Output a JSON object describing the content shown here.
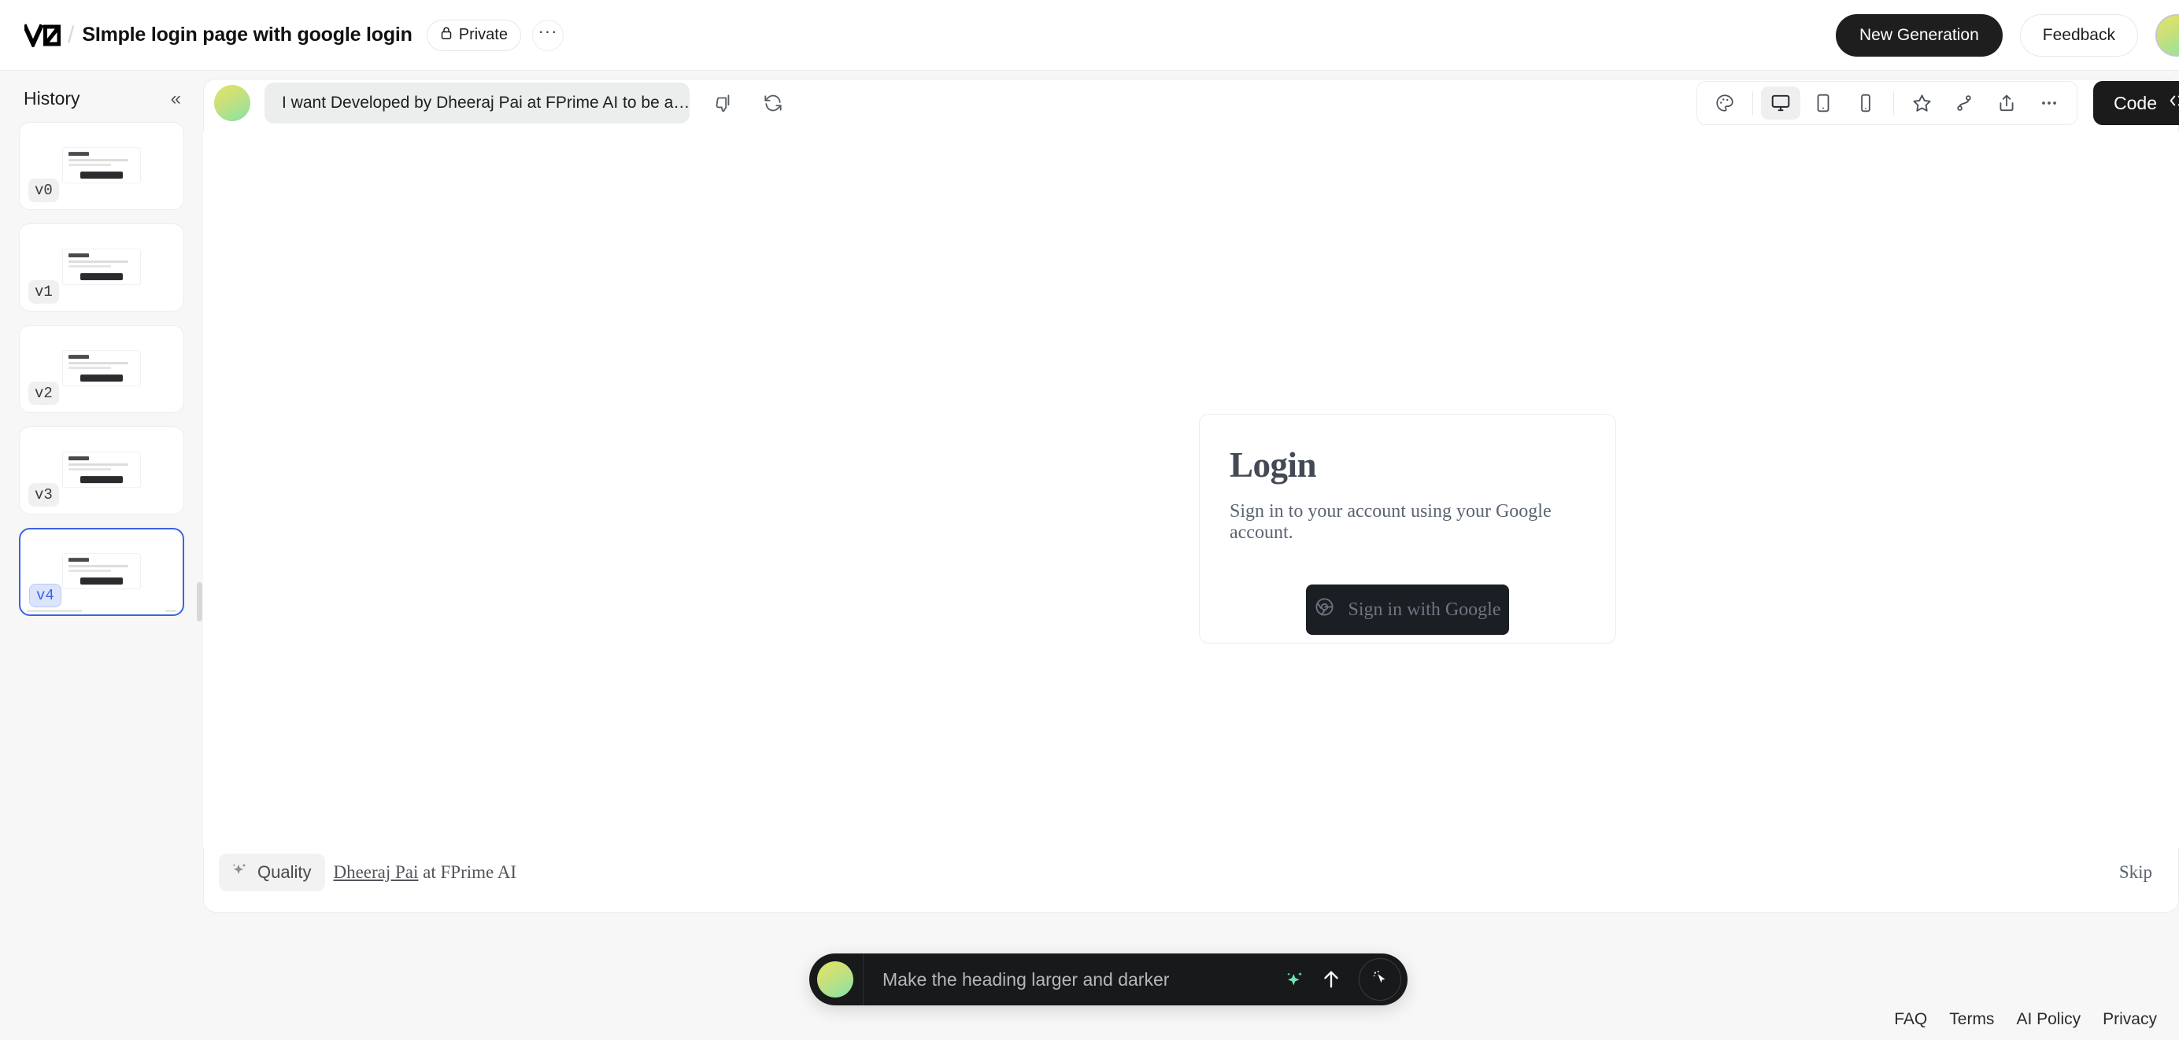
{
  "header": {
    "logo_icon": "v0-logo-icon",
    "separator": "/",
    "project_title": "SImple login page with google login",
    "privacy_label": "Private",
    "privacy_icon": "lock-icon",
    "more_label": "···",
    "new_generation_label": "New Generation",
    "feedback_label": "Feedback",
    "avatar_icon": "user-avatar"
  },
  "sidebar": {
    "title": "History",
    "collapse_icon": "chevrons-left-icon",
    "versions": [
      {
        "label": "v0",
        "selected": false
      },
      {
        "label": "v1",
        "selected": false
      },
      {
        "label": "v2",
        "selected": false
      },
      {
        "label": "v3",
        "selected": false
      },
      {
        "label": "v4",
        "selected": true
      }
    ]
  },
  "preview": {
    "prompt_message": "I want Developed by Dheeraj Pai at FPrime AI to be a…",
    "thumbs_down_icon": "thumbs-down-icon",
    "refresh_icon": "refresh-icon",
    "viewbar": {
      "theme_icon": "palette-icon",
      "desktop_icon": "monitor-icon",
      "tablet_icon": "tablet-icon",
      "mobile_icon": "phone-icon",
      "star_icon": "star-icon",
      "branch_icon": "git-branch-icon",
      "share_icon": "share-icon",
      "more_icon": "ellipsis-icon",
      "active_device": "desktop"
    },
    "code_button_label": "Code",
    "code_button_icon": "code-brackets-icon"
  },
  "login_card": {
    "title": "Login",
    "subtitle": "Sign in to your account using your Google account.",
    "button_label": "Sign in with Google",
    "button_icon": "chrome-icon"
  },
  "quality_bar": {
    "badge_label": "Quality",
    "badge_icon": "sparkles-icon",
    "credit_link": "Dheeraj Pai",
    "credit_suffix": " at FPrime AI",
    "skip_label": "Skip"
  },
  "prompt_bar": {
    "value": "Make the heading larger and darker",
    "placeholder": "Make the heading larger and darker",
    "enhance_icon": "sparkles-icon",
    "submit_icon": "arrow-up-icon",
    "select_icon": "cursor-select-icon",
    "avatar_icon": "user-avatar"
  },
  "footer": {
    "links": [
      "FAQ",
      "Terms",
      "AI Policy",
      "Privacy"
    ]
  },
  "colors": {
    "accent_dark": "#1b1b1b",
    "selection_blue": "#3b63e8",
    "sparkle_mint": "#6ee7b7",
    "page_bg": "#f7f7f7"
  }
}
